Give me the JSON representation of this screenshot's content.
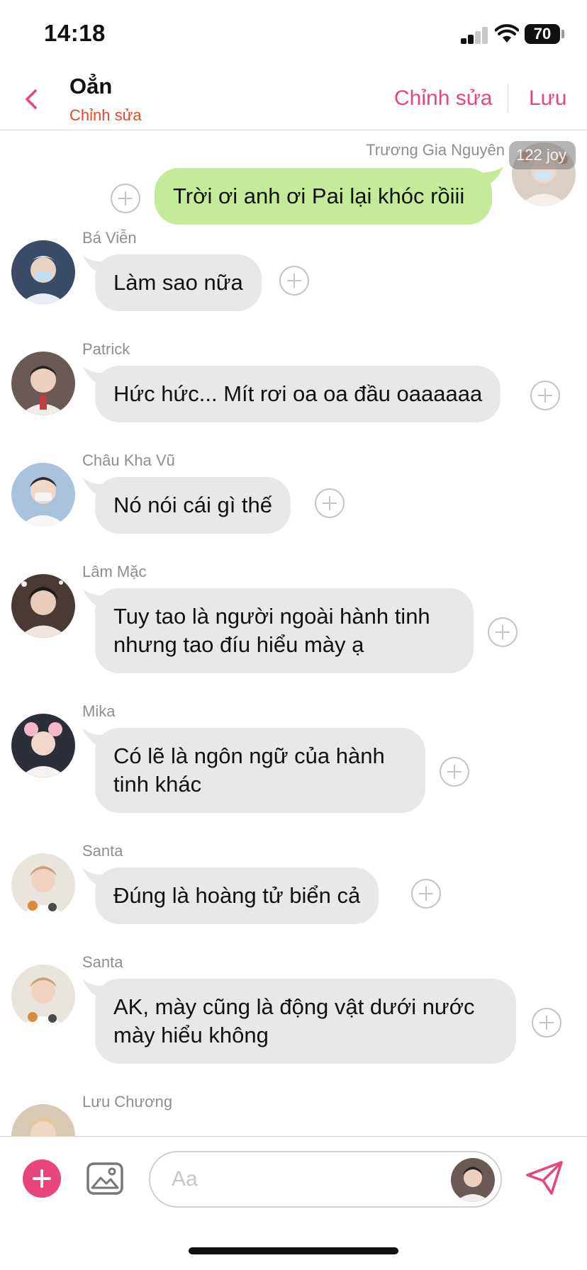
{
  "status_bar": {
    "time": "14:18",
    "battery": "70"
  },
  "header": {
    "title": "Oẳn",
    "subtitle": "Chỉnh sửa",
    "edit_label": "Chỉnh sửa",
    "save_label": "Lưu"
  },
  "messages": [
    {
      "sender": "Trương Gia Nguyên",
      "text": "Trời ơi anh ơi Pai lại khóc rồiii",
      "direction": "out",
      "badge": "122 joy"
    },
    {
      "sender": "Bá Viễn",
      "text": "Làm sao nữa",
      "direction": "in"
    },
    {
      "sender": "Patrick",
      "text": "Hức hức... Mít rơi oa oa đầu oaaaaaa",
      "direction": "in"
    },
    {
      "sender": "Châu Kha Vũ",
      "text": "Nó nói cái gì thế",
      "direction": "in"
    },
    {
      "sender": "Lâm Mặc",
      "text": "Tuy tao là người ngoài hành tinh nhưng tao đíu hiểu mày ạ",
      "direction": "in"
    },
    {
      "sender": "Mika",
      "text": "Có lẽ là ngôn ngữ của hành tinh khác",
      "direction": "in"
    },
    {
      "sender": "Santa",
      "text": "Đúng là hoàng tử biển cả",
      "direction": "in"
    },
    {
      "sender": "Santa",
      "text": "AK, mày cũng là động vật dưới nước mày hiểu không",
      "direction": "in"
    },
    {
      "sender": "Lưu Chương",
      "text": "",
      "direction": "in"
    }
  ],
  "input": {
    "placeholder": "Aa",
    "value": ""
  },
  "colors": {
    "accent": "#e8457f",
    "outgoing_bubble": "#c4ec98",
    "incoming_bubble": "#e6e8ea",
    "subtitle": "#e8452c"
  },
  "icons": [
    "back-chevron-icon",
    "plus-icon",
    "image-icon",
    "send-icon"
  ]
}
